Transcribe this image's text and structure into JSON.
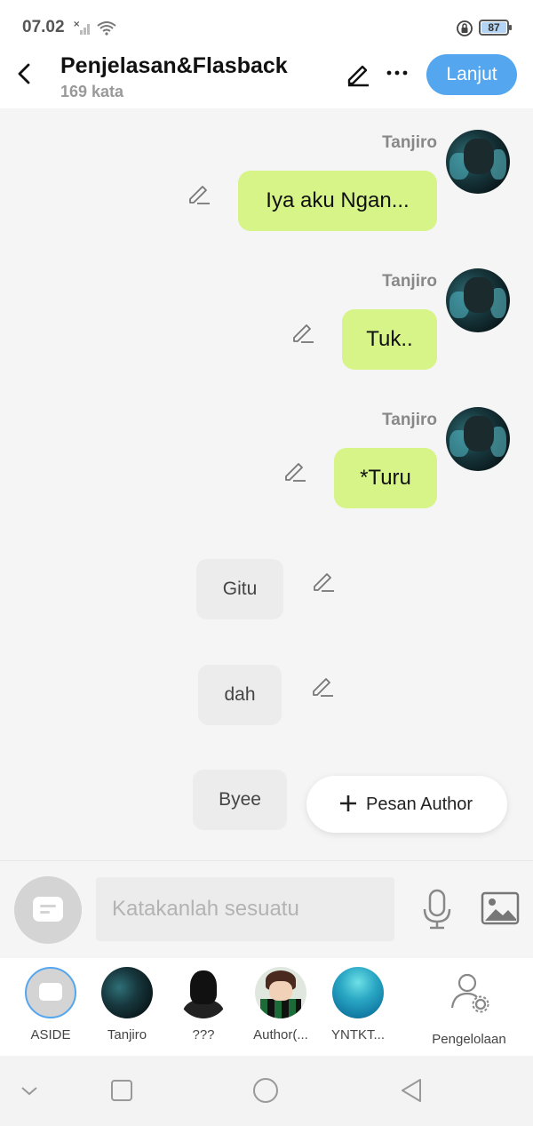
{
  "status_bar": {
    "time": "07.02",
    "battery": "87"
  },
  "header": {
    "title": "Penjelasan&Flasback",
    "word_count": "169 kata",
    "next_button": "Lanjut"
  },
  "messages": [
    {
      "sender": "Tanjiro",
      "text": "Iya aku Ngan...",
      "side": "right"
    },
    {
      "sender": "Tanjiro",
      "text": "Tuk..",
      "side": "right"
    },
    {
      "sender": "Tanjiro",
      "text": "*Turu",
      "side": "right"
    },
    {
      "sender": "",
      "text": "Gitu",
      "side": "center"
    },
    {
      "sender": "",
      "text": "dah",
      "side": "center"
    },
    {
      "sender": "",
      "text": "Byee",
      "side": "center"
    }
  ],
  "author_message_button": "Pesan Author",
  "composer": {
    "placeholder": "Katakanlah sesuatu"
  },
  "characters": [
    {
      "name": "ASIDE",
      "avatar": "aside-icon"
    },
    {
      "name": "Tanjiro",
      "avatar": "tanjiro-avatar"
    },
    {
      "name": "???",
      "avatar": "silhouette-avatar"
    },
    {
      "name": "Author(...",
      "avatar": "author-avatar"
    },
    {
      "name": "YNTKT...",
      "avatar": "planet-avatar"
    }
  ],
  "manage_label": "Pengelolaan",
  "colors": {
    "accent": "#54a6ef",
    "my_bubble": "#d7f489",
    "other_bubble": "#ececec",
    "background": "#f5f5f5"
  }
}
